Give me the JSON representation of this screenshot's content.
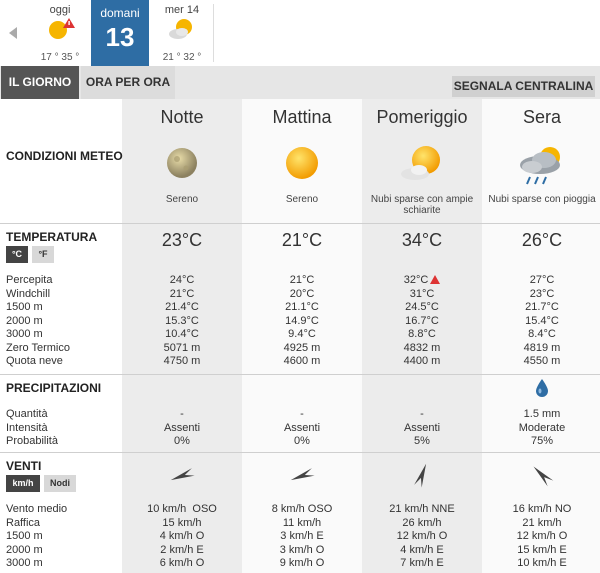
{
  "days": [
    {
      "name": "oggi",
      "temps": "17 ° 35 °",
      "icon": "sun-warning-icon"
    },
    {
      "name": "domani",
      "num": "13",
      "icon": ""
    },
    {
      "name": "mer 14",
      "temps": "21 ° 32 °",
      "icon": "partly-cloudy-icon"
    }
  ],
  "tabs": {
    "giorno": "IL GIORNO",
    "ora": "ORA PER ORA",
    "segnala": "SEGNALA CENTRALINA"
  },
  "sections": {
    "condizioni": "CONDIZIONI METEO",
    "temperatura": "TEMPERATURA",
    "precipitazioni": "PRECIPITAZIONI",
    "venti": "VENTI"
  },
  "units": {
    "c": "°C",
    "f": "°F",
    "kmh": "km/h",
    "nodi": "Nodi"
  },
  "temp_labels": "Percepita\nWindchill\n1500 m\n2000 m\n3000 m\nZero Termico\nQuota neve",
  "precip_labels": "Quantità\nIntensità\nProbabilità",
  "wind_labels": "Vento medio\nRaffica\n1500 m\n2000 m\n3000 m",
  "periods": [
    {
      "name": "Notte",
      "icon": "moon-clear-icon",
      "condition": "Sereno",
      "temp": "23°C",
      "percepita": "24°C",
      "temp_rows": "21°C\n21.4°C\n15.3°C\n10.4°C\n5071 m\n4750 m",
      "precip": "-\nAssenti\n0%",
      "wind": "10 km/h  OSO\n15 km/h\n4 km/h O\n2 km/h E\n6 km/h O",
      "wind_dir_deg": 250
    },
    {
      "name": "Mattina",
      "icon": "sun-icon",
      "condition": "Sereno",
      "temp": "21°C",
      "percepita": "21°C",
      "temp_rows": "20°C\n21.1°C\n14.9°C\n9.4°C\n4925 m\n4600 m",
      "precip": "-\nAssenti\n0%",
      "wind": "8 km/h OSO\n11 km/h\n3 km/h E\n3 km/h O\n9 km/h O",
      "wind_dir_deg": 250
    },
    {
      "name": "Pomeriggio",
      "icon": "sun-cloud-icon",
      "condition": "Nubi sparse con ampie schiarite",
      "temp": "34°C",
      "percepita": "32°C",
      "temp_rows": "31°C\n24.5°C\n16.7°C\n8.8°C\n4832 m\n4400 m",
      "precip": "-\nAssenti\n5%",
      "wind": "21 km/h NNE\n26 km/h\n12 km/h O\n4 km/h E\n7 km/h E",
      "wind_dir_deg": 20
    },
    {
      "name": "Sera",
      "icon": "cloud-rain-icon",
      "condition": "Nubi sparse con pioggia",
      "temp": "26°C",
      "percepita": "27°C",
      "temp_rows": "23°C\n21.7°C\n15.4°C\n8.4°C\n4819 m\n4550 m",
      "precip": "1.5 mm\nModerate\n75%",
      "wind": "16 km/h NO\n21 km/h\n12 km/h O\n15 km/h E\n10 km/h E",
      "wind_dir_deg": 315
    }
  ]
}
